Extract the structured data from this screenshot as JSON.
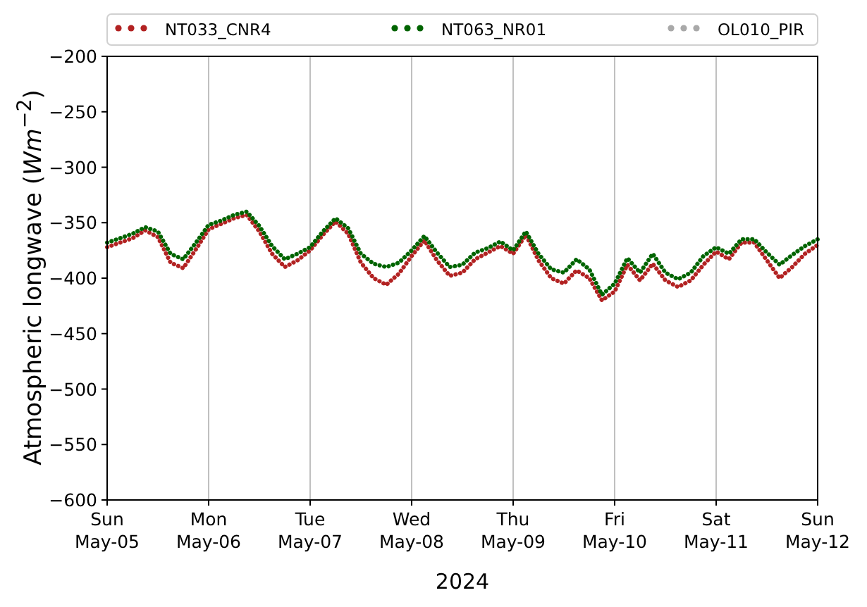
{
  "chart": {
    "chart_data": {
      "type": "line",
      "xlabel": "2024",
      "ylabel": "Atmospheric longwave (*Wm*$^{−2}$)",
      "categories": [
        "Sun\nMay-05",
        null,
        null,
        null,
        null,
        null,
        null,
        null,
        "Mon\nMay-06",
        null,
        null,
        null,
        null,
        null,
        null,
        null,
        "Tue\nMay-07",
        null,
        null,
        null,
        null,
        null,
        null,
        null,
        "Wed\nMay-08",
        null,
        null,
        null,
        null,
        null,
        null,
        null,
        "Thu\nMay-09",
        null,
        null,
        null,
        null,
        null,
        null,
        null,
        "Fri\nMay-10",
        null,
        null,
        null,
        null,
        null,
        null,
        null,
        "Sat\nMay-11",
        null,
        null,
        null,
        null,
        null,
        null,
        null,
        "Sun\nMay-12"
      ],
      "series": [
        {
          "name": "NT033_CNR4",
          "color": "#b22222",
          "line_style": "dotted",
          "values": [
            -372,
            -368,
            -364,
            -357,
            -363,
            -386,
            -391,
            -374,
            -356,
            -351,
            -346,
            -343,
            -358,
            -378,
            -390,
            -384,
            -375,
            -361,
            -349,
            -360,
            -386,
            -400,
            -406,
            -396,
            -380,
            -366,
            -384,
            -398,
            -395,
            -383,
            -377,
            -371,
            -378,
            -361,
            -384,
            -400,
            -405,
            -393,
            -400,
            -420,
            -412,
            -388,
            -402,
            -387,
            -402,
            -408,
            -402,
            -388,
            -376,
            -383,
            -368,
            -368,
            -384,
            -400,
            -390,
            -378,
            -370
          ]
        },
        {
          "name": "NT063_NR01",
          "color": "#006400",
          "line_style": "dotted",
          "values": [
            -368,
            -364,
            -360,
            -354,
            -358,
            -378,
            -383,
            -368,
            -352,
            -348,
            -343,
            -340,
            -353,
            -371,
            -383,
            -378,
            -372,
            -358,
            -346,
            -355,
            -378,
            -387,
            -390,
            -386,
            -375,
            -362,
            -377,
            -390,
            -388,
            -377,
            -373,
            -367,
            -375,
            -358,
            -378,
            -392,
            -395,
            -383,
            -392,
            -415,
            -405,
            -382,
            -395,
            -378,
            -395,
            -401,
            -395,
            -380,
            -372,
            -378,
            -365,
            -365,
            -377,
            -388,
            -379,
            -371,
            -365
          ]
        },
        {
          "name": "OL010_PIR",
          "color": "#a9a9a9",
          "line_style": "dotted",
          "values": [
            null,
            null,
            null,
            null,
            null,
            null,
            null,
            null,
            null,
            null,
            null,
            null,
            null,
            null,
            null,
            null,
            null,
            null,
            null,
            null,
            null,
            null,
            null,
            null,
            null,
            null,
            null,
            null,
            null,
            null,
            null,
            null,
            null,
            null,
            null,
            null,
            null,
            null,
            null,
            null,
            null,
            null,
            null,
            null,
            null,
            null,
            null,
            null,
            null,
            null,
            null,
            null,
            null,
            null,
            null,
            null,
            null
          ]
        }
      ],
      "ylim": [
        -600,
        -200
      ],
      "grid": "x",
      "legend": "top",
      "yticks": [
        {
          "value": -600,
          "label": "−600"
        },
        {
          "value": -550,
          "label": "−550"
        },
        {
          "value": -500,
          "label": "−500"
        },
        {
          "value": -450,
          "label": "−450"
        },
        {
          "value": -400,
          "label": "−400"
        },
        {
          "value": -350,
          "label": "−350"
        },
        {
          "value": -300,
          "label": "−300"
        },
        {
          "value": -250,
          "label": "−250"
        },
        {
          "value": -200,
          "label": "−200"
        }
      ]
    }
  }
}
